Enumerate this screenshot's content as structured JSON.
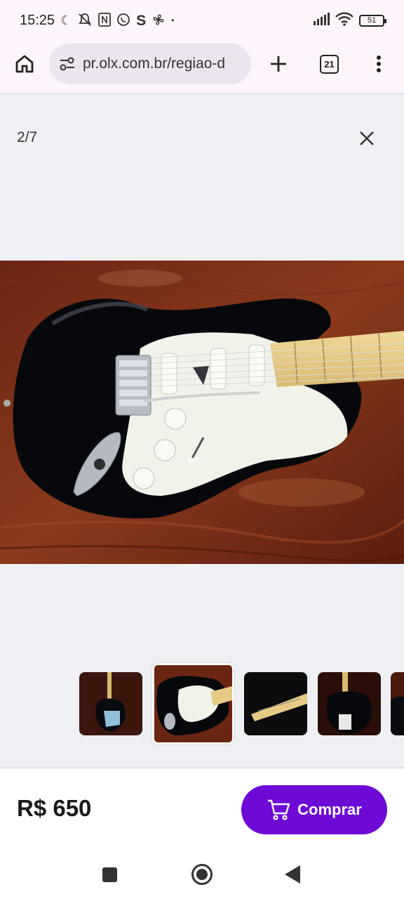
{
  "status": {
    "time": "15:25",
    "battery": "51",
    "left_icons": [
      "moon-icon",
      "mute-icon",
      "nfc-icon",
      "whatsapp-icon",
      "s-app-icon",
      "fan-icon",
      "dot-icon"
    ],
    "right_icons": [
      "signal-icon",
      "wifi-icon",
      "battery-icon"
    ]
  },
  "browser": {
    "url": "pr.olx.com.br/regiao-d",
    "tab_count": "21"
  },
  "gallery": {
    "counter": "2/7",
    "thumbnails_count_visible": 5,
    "active_thumbnail": 2
  },
  "purchase": {
    "price": "R$ 650",
    "button_label": "Comprar"
  },
  "colors": {
    "accent": "#6e0ad6",
    "background": "#eef0f4"
  }
}
